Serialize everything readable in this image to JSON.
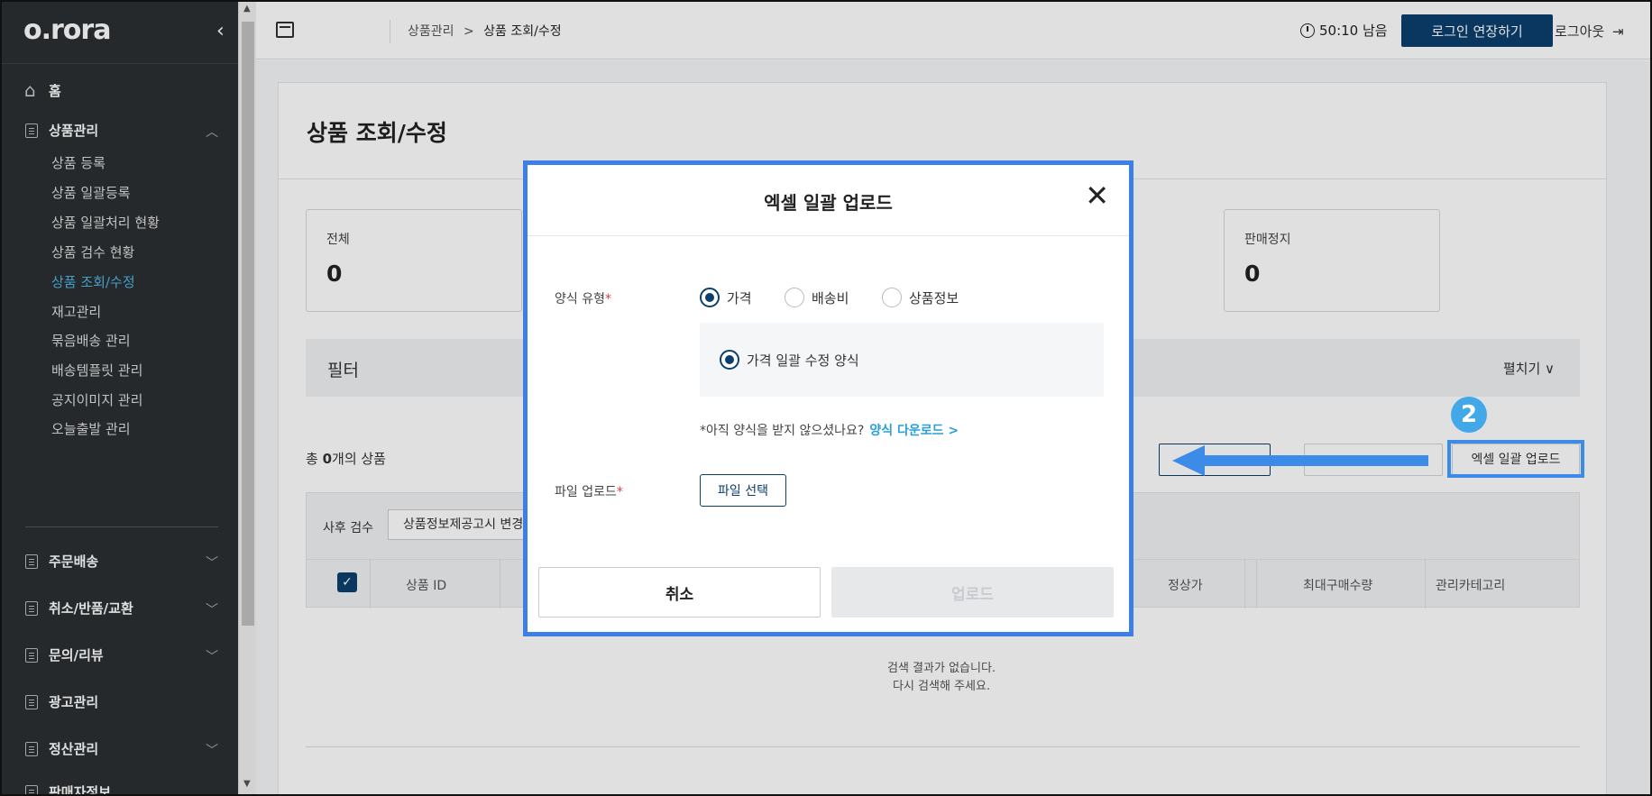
{
  "app": {
    "logo": "o.rora",
    "collapse_icon": "‹"
  },
  "sidebar": {
    "home": "홈",
    "product_mgmt": "상품관리",
    "sub_items": [
      "상품 등록",
      "상품 일괄등록",
      "상품 일괄처리 현황",
      "상품 검수 현황",
      "상품 조회/수정",
      "재고관리",
      "묶음배송 관리",
      "배송템플릿 관리",
      "공지이미지 관리",
      "오늘출발 관리"
    ],
    "active_sub": "상품 조회/수정",
    "groups": [
      "주문배송",
      "취소/반품/교환",
      "문의/리뷰",
      "광고관리",
      "정산관리",
      "판매자정보"
    ]
  },
  "topbar": {
    "breadcrumb_parent": "상품관리",
    "breadcrumb_sep": ">",
    "breadcrumb_current": "상품 조회/수정",
    "timer": "50:10 남음",
    "extend_login": "로그인 연장하기",
    "logout": "로그아웃"
  },
  "page": {
    "title": "상품 조회/수정",
    "stats": [
      {
        "label": "전체",
        "value": "0"
      },
      {
        "label": "판매정지",
        "value": "0"
      }
    ],
    "filter_title": "필터",
    "filter_expand": "펼치기 ∨",
    "count_prefix": "총 ",
    "count_value": "0",
    "count_suffix": "개의 상품",
    "excel_upload_button": "엑셀 일괄 업로드",
    "step_badge": "2",
    "post_review_label": "사후 검수",
    "post_review_select": "상품정보제공고시 변경",
    "columns": [
      "상품 ID",
      "정상가",
      "최대구매수량",
      "관리카테고리"
    ],
    "empty_line1": "검색 결과가 없습니다.",
    "empty_line2": "다시 검색해 주세요."
  },
  "modal": {
    "title": "엑셀 일괄 업로드",
    "close": "✕",
    "format_type_label": "양식 유형",
    "required_mark": "*",
    "format_options": [
      "가격",
      "배송비",
      "상품정보"
    ],
    "selected_format": "가격",
    "sub_option": "가격 일괄 수정 양식",
    "hint": "*아직 양식을 받지 않으셨나요?",
    "download_link": "양식 다운로드 >",
    "file_upload_label": "파일 업로드",
    "file_select_button": "파일 선택",
    "cancel": "취소",
    "upload": "업로드"
  },
  "colors": {
    "primary": "#0c3f6e",
    "accent": "#43a8e8",
    "highlight": "#3d7fe6",
    "sidebar_bg": "#2b2f33",
    "active_menu": "#4fb6e3"
  }
}
